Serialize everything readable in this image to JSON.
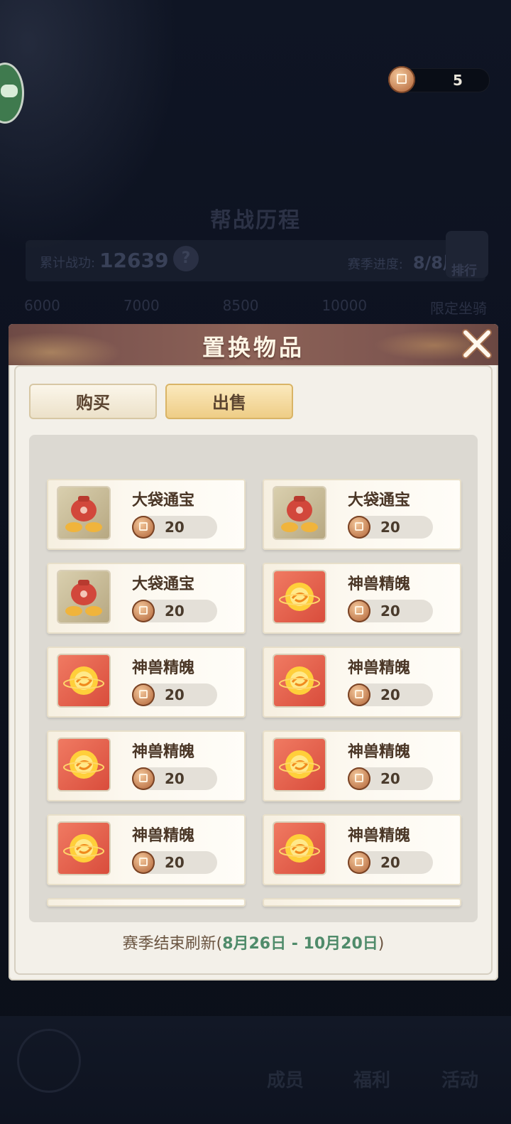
{
  "currency": {
    "amount": "5"
  },
  "background": {
    "title": "帮战历程",
    "merit_label": "累计战功:",
    "merit_value": "12639",
    "help": "?",
    "season_progress_label": "赛季进度:",
    "season_progress_value": "8/8周",
    "rank_label": "排行",
    "milestones": [
      "6000",
      "7000",
      "8500",
      "10000",
      "限定坐骑"
    ],
    "nav": {
      "members": "成员",
      "welfare": "福利",
      "activity": "活动"
    }
  },
  "modal": {
    "title": "置换物品",
    "tabs": {
      "buy": "购买",
      "sell": "出售"
    },
    "active_tab": "sell",
    "items": [
      {
        "name": "大袋通宝",
        "price": "20",
        "icon": "coin-bag-icon"
      },
      {
        "name": "大袋通宝",
        "price": "20",
        "icon": "coin-bag-icon"
      },
      {
        "name": "大袋通宝",
        "price": "20",
        "icon": "coin-bag-icon"
      },
      {
        "name": "神兽精魄",
        "price": "20",
        "icon": "spirit-orb-icon"
      },
      {
        "name": "神兽精魄",
        "price": "20",
        "icon": "spirit-orb-icon"
      },
      {
        "name": "神兽精魄",
        "price": "20",
        "icon": "spirit-orb-icon"
      },
      {
        "name": "神兽精魄",
        "price": "20",
        "icon": "spirit-orb-icon"
      },
      {
        "name": "神兽精魄",
        "price": "20",
        "icon": "spirit-orb-icon"
      },
      {
        "name": "神兽精魄",
        "price": "20",
        "icon": "spirit-orb-icon"
      },
      {
        "name": "神兽精魄",
        "price": "20",
        "icon": "spirit-orb-icon"
      }
    ],
    "footer": {
      "prefix": "赛季结束刷新(",
      "dates": "8月26日 - 10月20日",
      "suffix": ")"
    }
  },
  "colors": {
    "header": "#7e5650",
    "tab_active": "#eecd86",
    "date_green": "#4f8b6a"
  }
}
